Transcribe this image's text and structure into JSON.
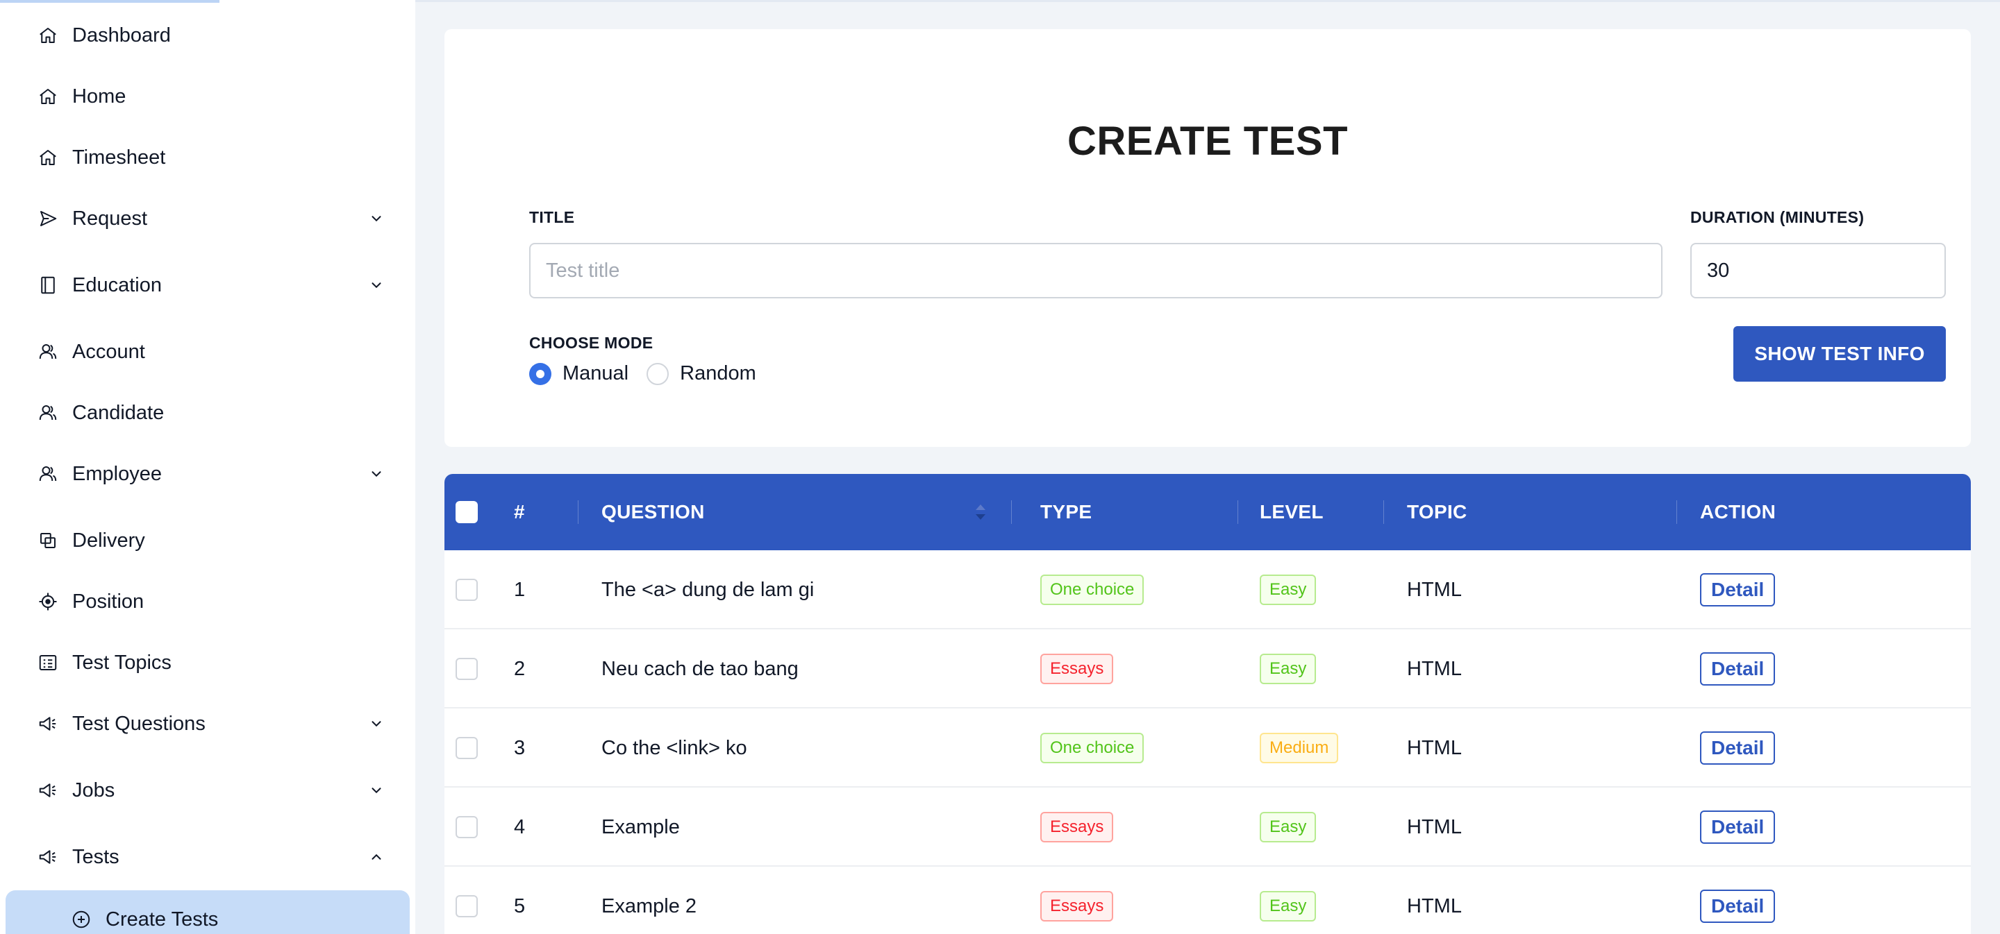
{
  "sidebar": {
    "items": [
      {
        "label": "Dashboard",
        "icon": "home-icon"
      },
      {
        "label": "Home",
        "icon": "home-icon"
      },
      {
        "label": "Timesheet",
        "icon": "home-icon"
      },
      {
        "label": "Request",
        "icon": "send-icon",
        "expanded": false
      },
      {
        "label": "Education",
        "icon": "book-icon",
        "expanded": false
      },
      {
        "label": "Account",
        "icon": "users-icon"
      },
      {
        "label": "Candidate",
        "icon": "users-icon"
      },
      {
        "label": "Employee",
        "icon": "users-icon",
        "expanded": false
      },
      {
        "label": "Delivery",
        "icon": "copy-icon"
      },
      {
        "label": "Position",
        "icon": "target-icon"
      },
      {
        "label": "Test Topics",
        "icon": "list-icon"
      },
      {
        "label": "Test Questions",
        "icon": "megaphone-icon",
        "expanded": false
      },
      {
        "label": "Jobs",
        "icon": "megaphone-icon",
        "expanded": false
      },
      {
        "label": "Tests",
        "icon": "megaphone-icon",
        "expanded": true
      }
    ],
    "sub_items": [
      {
        "label": "Create Tests",
        "icon": "plus-circle-icon",
        "active": true
      }
    ]
  },
  "form": {
    "title": "CREATE TEST",
    "title_label": "TITLE",
    "title_placeholder": "Test title",
    "title_value": "",
    "duration_label": "DURATION (MINUTES)",
    "duration_value": "30",
    "mode_label": "CHOOSE MODE",
    "modes": [
      {
        "label": "Manual",
        "checked": true
      },
      {
        "label": "Random",
        "checked": false
      }
    ],
    "show_info_button": "SHOW TEST INFO"
  },
  "table": {
    "headers": {
      "num": "#",
      "question": "QUESTION",
      "type": "TYPE",
      "level": "LEVEL",
      "topic": "TOPIC",
      "action": "ACTION"
    },
    "rows": [
      {
        "num": "1",
        "question": "The <a> dung de lam gi",
        "type": "One choice",
        "level": "Easy",
        "topic": "HTML",
        "action": "Detail"
      },
      {
        "num": "2",
        "question": "Neu cach de tao bang",
        "type": "Essays",
        "level": "Easy",
        "topic": "HTML",
        "action": "Detail"
      },
      {
        "num": "3",
        "question": "Co the <link> ko",
        "type": "One choice",
        "level": "Medium",
        "topic": "HTML",
        "action": "Detail"
      },
      {
        "num": "4",
        "question": "Example",
        "type": "Essays",
        "level": "Easy",
        "topic": "HTML",
        "action": "Detail"
      },
      {
        "num": "5",
        "question": "Example 2",
        "type": "Essays",
        "level": "Easy",
        "topic": "HTML",
        "action": "Detail"
      }
    ]
  },
  "colors": {
    "primary": "#2f58bf",
    "radio_checked": "#3570e6",
    "active_nav_bg": "#c6dcf8",
    "tag_green": "#52c41a",
    "tag_red": "#f5222d",
    "tag_orange": "#faad14"
  }
}
